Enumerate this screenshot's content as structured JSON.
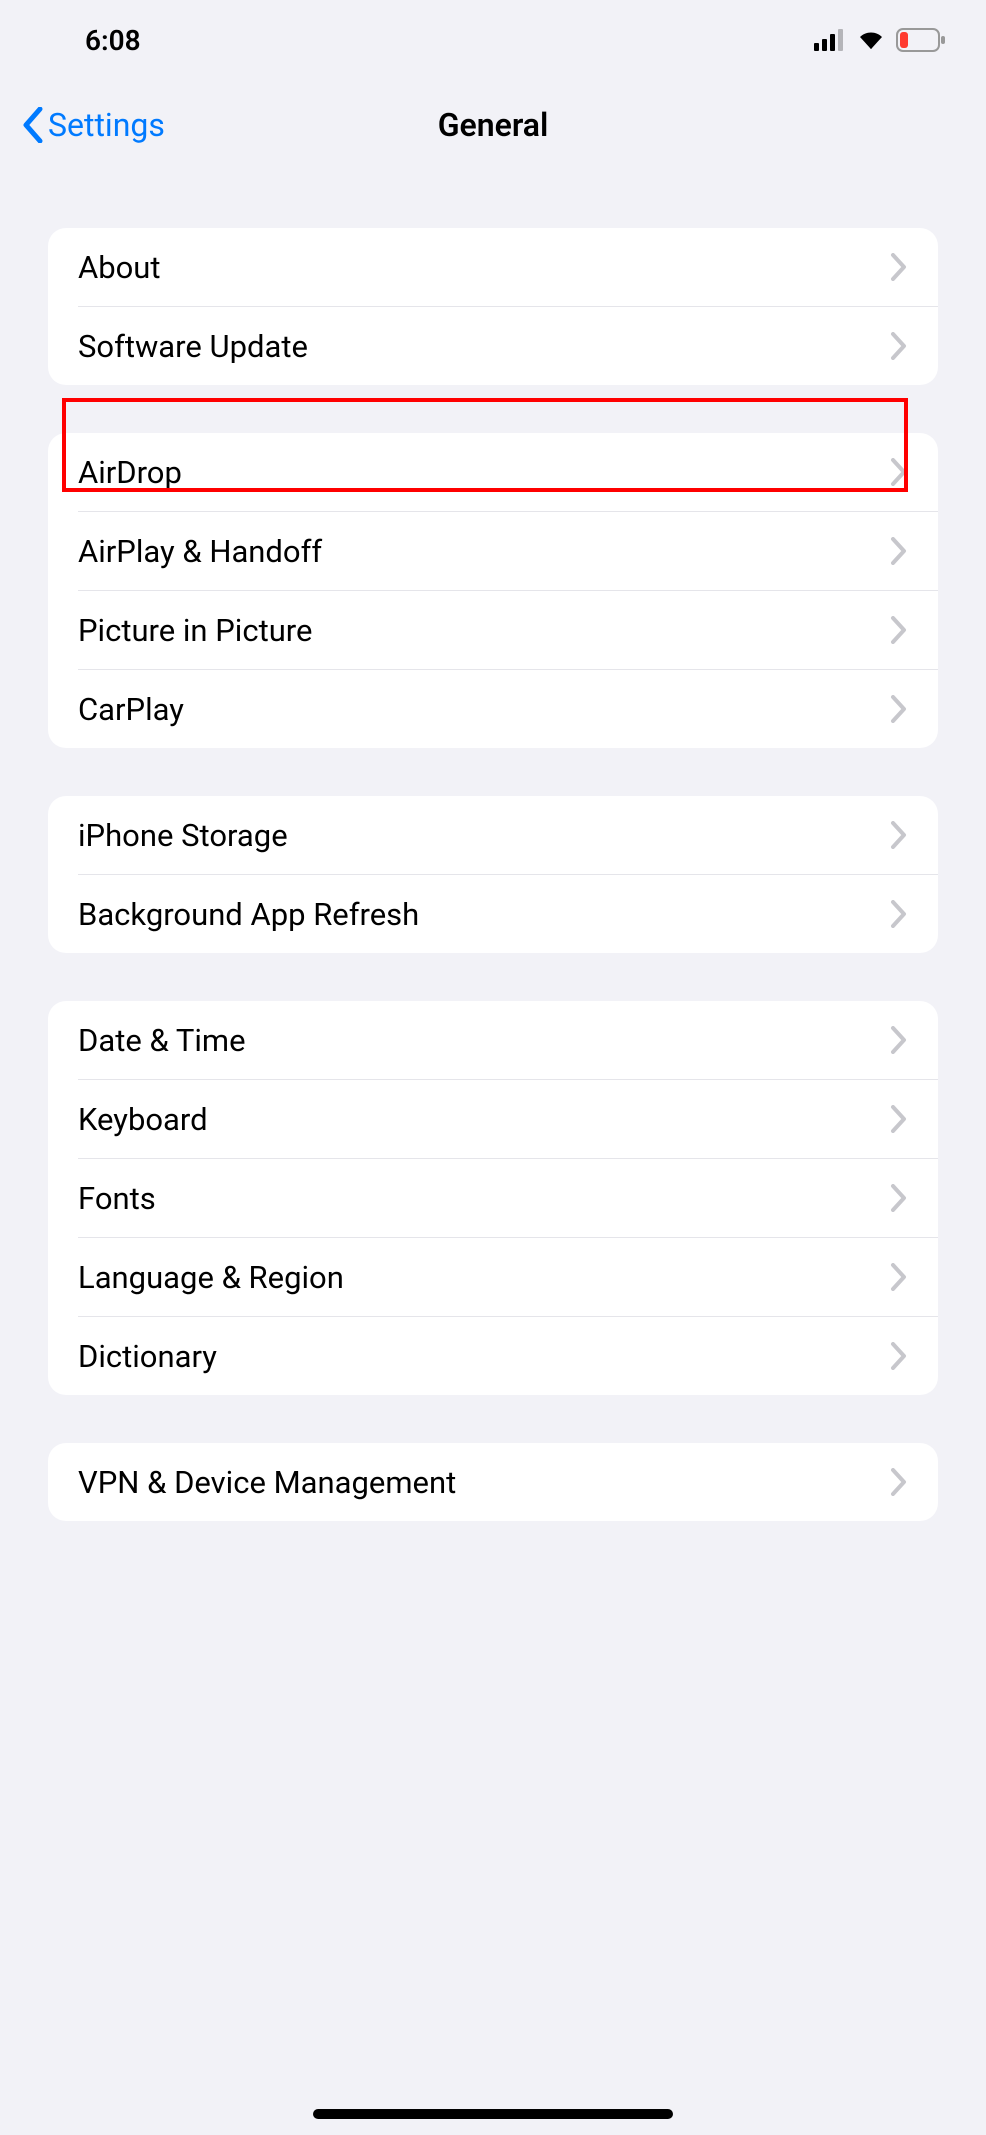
{
  "statusBar": {
    "time": "6:08"
  },
  "navBar": {
    "backLabel": "Settings",
    "title": "General"
  },
  "groups": [
    {
      "rows": [
        {
          "label": "About"
        },
        {
          "label": "Software Update"
        }
      ]
    },
    {
      "rows": [
        {
          "label": "AirDrop"
        },
        {
          "label": "AirPlay & Handoff"
        },
        {
          "label": "Picture in Picture"
        },
        {
          "label": "CarPlay"
        }
      ]
    },
    {
      "rows": [
        {
          "label": "iPhone Storage"
        },
        {
          "label": "Background App Refresh"
        }
      ]
    },
    {
      "rows": [
        {
          "label": "Date & Time"
        },
        {
          "label": "Keyboard"
        },
        {
          "label": "Fonts"
        },
        {
          "label": "Language & Region"
        },
        {
          "label": "Dictionary"
        }
      ]
    },
    {
      "rows": [
        {
          "label": "VPN & Device Management"
        }
      ]
    }
  ]
}
